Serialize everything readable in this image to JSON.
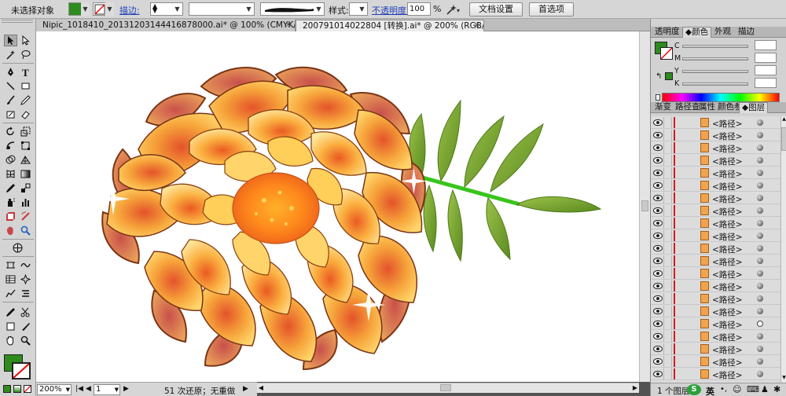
{
  "control_bar": {
    "selection_status": "未选择对象",
    "stroke_label": "描边:",
    "style_label": "样式:",
    "opacity_label": "不透明度:",
    "opacity_value": "100",
    "opacity_unit": "%",
    "doc_setup_button": "文档设置",
    "preferences_button": "首选项",
    "fill_color": "#2e8b1e"
  },
  "tabs": [
    {
      "label": "Nipic_1018410_20131203144416878000.ai* @ 100% (CMYK/预览)",
      "close": "×"
    },
    {
      "label": "20079101402​2804  [转换].ai* @ 200% (RGB/预览)",
      "close": "×"
    }
  ],
  "status_bar": {
    "zoom": "200%",
    "page": "1",
    "info": "51 次还原；无重做"
  },
  "panels": {
    "top_tabs": [
      "透明度",
      "颜色",
      "外观",
      "描边"
    ],
    "active_top_tab": "颜色",
    "color_channels": [
      "C",
      "M",
      "Y",
      "K"
    ],
    "bottom_tabs": [
      "渐变",
      "路径查",
      "属性",
      "颜色参",
      "图层"
    ],
    "active_bottom_tab": "图层",
    "layers_footer": "1 个图层",
    "layer_name": "<路径>",
    "layers": [
      "<路径>",
      "<路径>",
      "<路径>",
      "<路径>",
      "<路径>",
      "<路径>",
      "<路径>",
      "<路径>",
      "<路径>",
      "<路径>",
      "<路径>",
      "<路径>",
      "<路径>",
      "<路径>",
      "<路径>",
      "<路径>",
      "<路径>",
      "<路径>",
      "<路径>",
      "<路径>",
      "<路径>"
    ],
    "hollow_target_index": 16,
    "ime_label": "英"
  },
  "colors": {
    "fill": "#2e8b1e",
    "accent_link": "#1e3fb8",
    "layer_marker": "#d21c1c"
  }
}
